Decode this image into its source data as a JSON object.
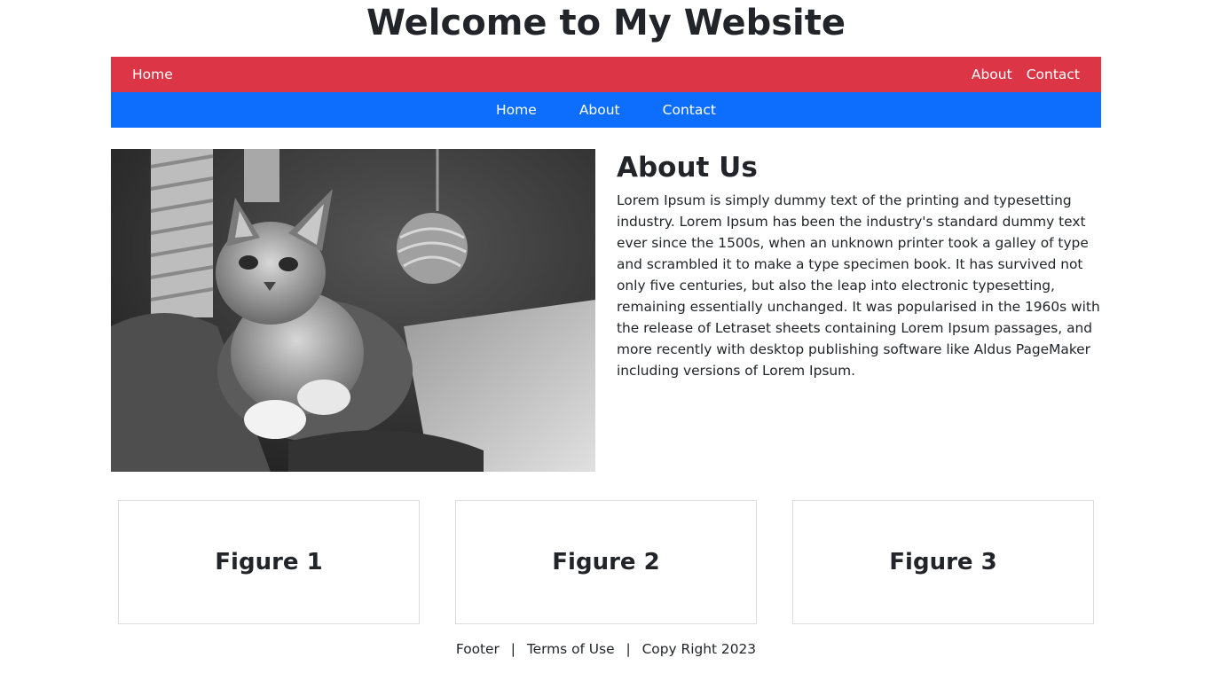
{
  "page": {
    "title": "Welcome to My Website"
  },
  "nav_top": {
    "brand": "Home",
    "links": [
      "About",
      "Contact"
    ],
    "color": "#dc3545"
  },
  "nav_secondary": {
    "links": [
      "Home",
      "About",
      "Contact"
    ],
    "color": "#0d6efd"
  },
  "hero": {
    "image": "kitten-photo-grayscale",
    "heading": "About Us",
    "text": "Lorem Ipsum is simply dummy text of the printing and typesetting industry. Lorem Ipsum has been the industry's standard dummy text ever since the 1500s, when an unknown printer took a galley of type and scrambled it to make a type specimen book. It has survived not only five centuries, but also the leap into electronic typesetting, remaining essentially unchanged. It was popularised in the 1960s with the release of Letraset sheets containing Lorem Ipsum passages, and more recently with desktop publishing software like Aldus PageMaker including versions of Lorem Ipsum."
  },
  "figures": [
    "Figure 1",
    "Figure 2",
    "Figure 3"
  ],
  "footer": {
    "items": [
      "Footer",
      "Terms of Use",
      "Copy Right 2023"
    ],
    "separator": "|"
  }
}
